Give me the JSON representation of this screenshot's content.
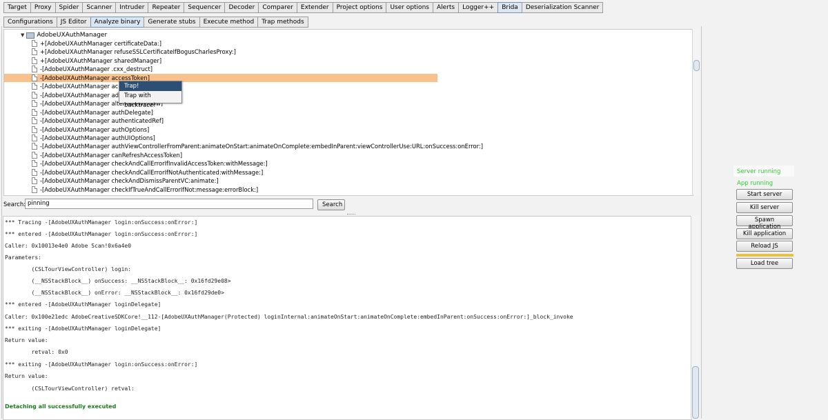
{
  "top_tabs": [
    "Target",
    "Proxy",
    "Spider",
    "Scanner",
    "Intruder",
    "Repeater",
    "Sequencer",
    "Decoder",
    "Comparer",
    "Extender",
    "Project options",
    "User options",
    "Alerts",
    "Logger++",
    "Brida",
    "Deserialization Scanner"
  ],
  "active_top_tab": "Brida",
  "sub_tabs": [
    "Configurations",
    "JS Editor",
    "Analyze binary",
    "Generate stubs",
    "Execute method",
    "Trap methods"
  ],
  "active_sub_tab": "Analyze binary",
  "tree": {
    "root": "AdobeUXAuthManager",
    "items": [
      "+[AdobeUXAuthManager certificateData:]",
      "+[AdobeUXAuthManager refuseSSLCertificateIfBogusCharlesProxy:]",
      "+[AdobeUXAuthManager sharedManager]",
      "-[AdobeUXAuthManager .cxx_destruct]",
      "-[AdobeUXAuthManager accessToken]",
      "-[AdobeUXAuthManager accoun",
      "-[AdobeUXAuthManager adobeI",
      "-[AdobeUXAuthManager alternateWindow]",
      "-[AdobeUXAuthManager authDelegate]",
      "-[AdobeUXAuthManager authenticatedRef]",
      "-[AdobeUXAuthManager authOptions]",
      "-[AdobeUXAuthManager authUIOptions]",
      "-[AdobeUXAuthManager authViewControllerFromParent:animateOnStart:animateOnComplete:embedInParent:viewControllerUse:URL:onSuccess:onError:]",
      "-[AdobeUXAuthManager canRefreshAccessToken]",
      "-[AdobeUXAuthManager checkAndCallErrorIfInvalidAccessToken:withMessage:]",
      "-[AdobeUXAuthManager checkAndCallErrorIfNotAuthenticated:withMessage:]",
      "-[AdobeUXAuthManager checkAndDismissParentVC:animate:]",
      "-[AdobeUXAuthManager checkIfTrueAndCallErrorIfNot:message:errorBlock:]"
    ],
    "selected_index": 4
  },
  "context_menu": [
    "Trap!",
    "Trap with backtrace!"
  ],
  "search": {
    "label": "Search:",
    "value": "pinning",
    "button": "Search"
  },
  "console_lines": [
    "*** Tracing -[AdobeUXAuthManager login:onSuccess:onError:]",
    "*** entered -[AdobeUXAuthManager login:onSuccess:onError:]",
    "Caller: 0x10013e4e0 Adobe Scan!0x6a4e0",
    "Parameters:",
    "        (CSLTourViewController) login:",
    "        (__NSStackBlock__) onSuccess: __NSStackBlock__: 0x16fd29e08>",
    "        (__NSStackBlock__) onError: __NSStackBlock__: 0x16fd29de0>",
    "*** entered -[AdobeUXAuthManager loginDelegate]",
    "Caller: 0x100e21edc AdobeCreativeSDKCore!__112-[AdobeUXAuthManager(Protected) loginInternal:animateOnStart:animateOnComplete:embedInParent:onSuccess:onError:]_block_invoke",
    "*** exiting -[AdobeUXAuthManager loginDelegate]",
    "Return value:",
    "        retval: 0x0",
    "*** exiting -[AdobeUXAuthManager login:onSuccess:onError:]",
    "Return value:",
    "        (CSLTourViewController) retval:"
  ],
  "console_final": "Detaching all successfully executed",
  "status": {
    "server": "Server running",
    "app": "App running"
  },
  "side_buttons": {
    "start_server": "Start server",
    "kill_server": "Kill server",
    "spawn_application": "Spawn application",
    "kill_application": "Kill application",
    "reload_js": "Reload JS",
    "load_tree": "Load tree"
  }
}
